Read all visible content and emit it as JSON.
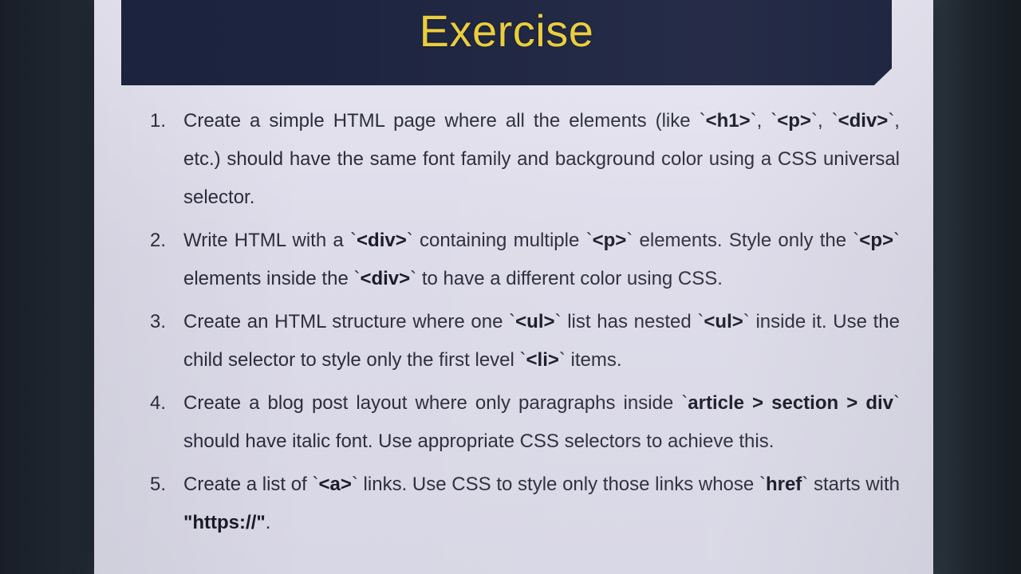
{
  "slide": {
    "title": "Exercise",
    "colors": {
      "header_background": "#1d2440",
      "title_text": "#e8cd3c",
      "slide_background": "#e3e1ee",
      "body_text": "#2c2d3c"
    },
    "exercises": [
      {
        "number": "1.",
        "parts": [
          {
            "t": "Create a simple HTML page where all the elements (like `",
            "b": false
          },
          {
            "t": "<h1>",
            "b": true
          },
          {
            "t": "`, `",
            "b": false
          },
          {
            "t": "<p>",
            "b": true
          },
          {
            "t": "`, `",
            "b": false
          },
          {
            "t": "<div>",
            "b": true
          },
          {
            "t": "`, etc.) should have the same font family and background color using a CSS universal selector.",
            "b": false
          }
        ]
      },
      {
        "number": "2.",
        "parts": [
          {
            "t": "Write HTML with a `",
            "b": false
          },
          {
            "t": "<div>",
            "b": true
          },
          {
            "t": "` containing multiple `",
            "b": false
          },
          {
            "t": "<p>",
            "b": true
          },
          {
            "t": "` elements. Style only the `",
            "b": false
          },
          {
            "t": "<p>",
            "b": true
          },
          {
            "t": "` elements inside the `",
            "b": false
          },
          {
            "t": "<div>",
            "b": true
          },
          {
            "t": "` to have a different color using CSS.",
            "b": false
          }
        ]
      },
      {
        "number": "3.",
        "parts": [
          {
            "t": "Create an HTML structure where one `",
            "b": false
          },
          {
            "t": "<ul>",
            "b": true
          },
          {
            "t": "` list has nested `",
            "b": false
          },
          {
            "t": "<ul>",
            "b": true
          },
          {
            "t": "` inside it. Use the child selector to style only the first level `",
            "b": false
          },
          {
            "t": "<li>",
            "b": true
          },
          {
            "t": "` items.",
            "b": false
          }
        ]
      },
      {
        "number": "4.",
        "parts": [
          {
            "t": "Create a blog post layout where only paragraphs inside `",
            "b": false
          },
          {
            "t": "article > section > div",
            "b": true
          },
          {
            "t": "` should have italic font. Use appropriate CSS selectors to achieve this.",
            "b": false
          }
        ]
      },
      {
        "number": "5.",
        "parts": [
          {
            "t": "Create a list of `",
            "b": false
          },
          {
            "t": "<a>",
            "b": true
          },
          {
            "t": "` links. Use CSS to style only those links whose `",
            "b": false
          },
          {
            "t": "href",
            "b": true
          },
          {
            "t": "` starts with ",
            "b": false
          },
          {
            "t": "\"https://\"",
            "b": true
          },
          {
            "t": ".",
            "b": false
          }
        ]
      }
    ]
  }
}
